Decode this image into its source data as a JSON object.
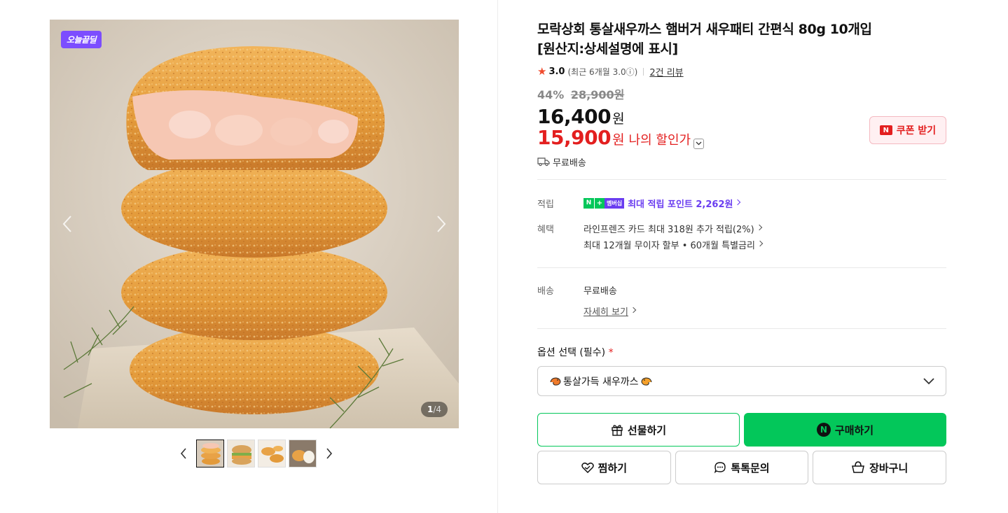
{
  "gallery": {
    "badge": "오늘끝딜",
    "counter_current": "1",
    "counter_total": "/4",
    "thumbnails": [
      "thumb-1",
      "thumb-2",
      "thumb-3",
      "thumb-4"
    ]
  },
  "product": {
    "title_line1": "모락상회 통살새우까스 햄버거 새우패티 간편식 80g 10개입",
    "title_line2": "[원산지:상세설명에 표시]",
    "rating": "3.0",
    "rating_recent": "(최근 6개월 3.0ⓘ)",
    "review_link": "2건 리뷰",
    "discount_rate": "44%",
    "original_price": "28,900원",
    "price": "16,400",
    "price_unit": "원",
    "my_price": "15,900",
    "my_price_unit": "원",
    "my_price_label": "나의 할인가",
    "coupon_label": "쿠폰 받기",
    "coupon_icon_text": "N",
    "shipping_summary": "무료배송"
  },
  "details": {
    "points_key": "적립",
    "points_text": "최대 적립 포인트 2,262원",
    "npay_n": "N",
    "npay_plus": "+",
    "npay_mem": "멤버십",
    "benefit_key": "혜택",
    "benefit_line1": "라인프렌즈 카드 최대 318원 추가 적립(2%)",
    "benefit_line2": "최대 12개월 무이자 할부 • 60개월 특별금리",
    "shipping_key": "배송",
    "shipping_value": "무료배송",
    "shipping_more": "자세히 보기"
  },
  "option": {
    "label": "옵션 선택 (필수)",
    "required_mark": "*",
    "selected_value": "통살가득 새우까스"
  },
  "actions": {
    "gift": "선물하기",
    "buy": "구매하기",
    "buy_icon_text": "N",
    "wish": "찜하기",
    "talk": "톡톡문의",
    "cart": "장바구니"
  },
  "colors": {
    "naver_green": "#03c75a",
    "price_red": "#e31f1f",
    "badge_purple": "#7c4dff",
    "points_purple": "#6a3df0"
  }
}
